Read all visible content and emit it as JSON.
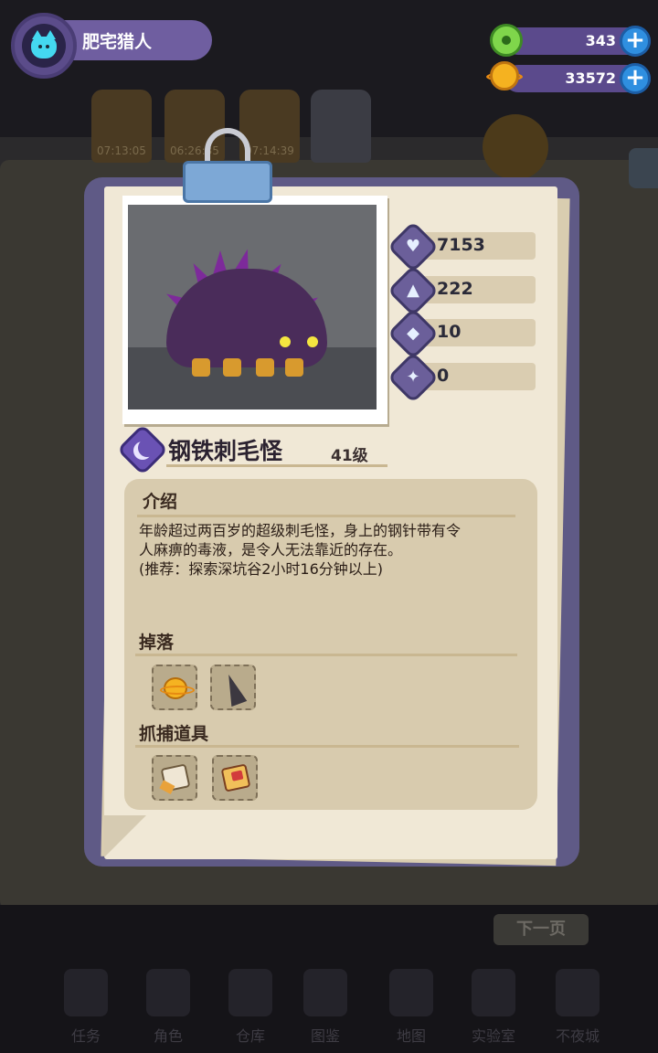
{
  "player": {
    "name": "肥宅猎人"
  },
  "currencies": [
    {
      "icon": "donut-icon",
      "value": "343"
    },
    {
      "icon": "gold-planet-coin-icon",
      "value": "33572"
    }
  ],
  "background": {
    "timers": [
      "07:13:05",
      "06:26:35",
      "07:14:39"
    ],
    "next_page": "下一页",
    "nav": [
      "任务",
      "角色",
      "仓库",
      "图鉴",
      "地图",
      "实验室",
      "不夜城"
    ]
  },
  "monster": {
    "name": "钢铁刺毛怪",
    "level": "41级",
    "stats": [
      {
        "icon": "heart-icon",
        "value": "7153"
      },
      {
        "icon": "attack-icon",
        "value": "222"
      },
      {
        "icon": "shield-icon",
        "value": "10"
      },
      {
        "icon": "speed-icon",
        "value": "0"
      }
    ]
  },
  "info": {
    "intro_title": "介绍",
    "intro_lines": [
      "年龄超过两百岁的超级刺毛怪，身上的钢针带有令",
      "人麻痹的毒液，是令人无法靠近的存在。",
      "(推荐：探索深坑谷2小时16分钟以上)"
    ],
    "drops_title": "掉落",
    "drops": [
      "gold-planet-coin-icon",
      "dark-horn-icon"
    ],
    "tools_title": "抓捕道具",
    "tools": [
      "paper-scroll-icon",
      "red-scroll-icon"
    ]
  },
  "colors": {
    "board": "#5f5a86",
    "paper": "#f0e8d6",
    "panel": "#d8cbae",
    "accent": "#6b5f9a"
  }
}
